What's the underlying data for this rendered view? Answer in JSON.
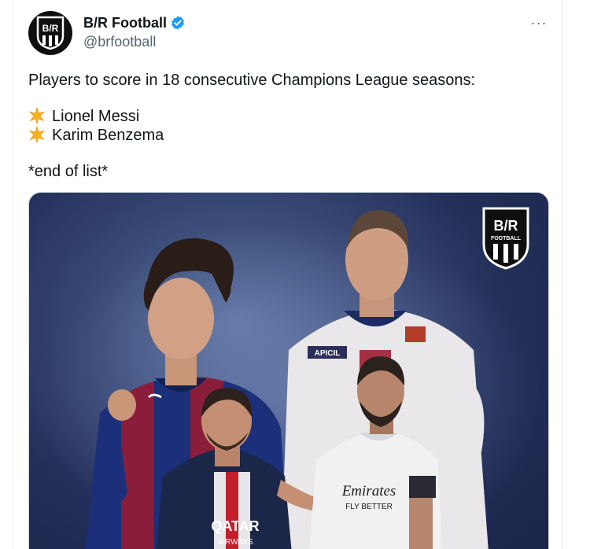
{
  "account": {
    "name": "B/R Football",
    "handle": "@brfootball",
    "avatar_icon": "br-logo-icon",
    "verified_icon": "verified-badge-icon",
    "avatar_text": "B/R"
  },
  "menu": {
    "more_icon": "more-horizontal-icon",
    "more_label": "···"
  },
  "tweet": {
    "headline": "Players to score in 18 consecutive Champions League seasons:",
    "players": [
      {
        "icon": "star-emoji-icon",
        "name": "Lionel Messi"
      },
      {
        "icon": "star-emoji-icon",
        "name": "Karim Benzema"
      }
    ],
    "footer": "*end of list*"
  },
  "media": {
    "logo_text": "B/R",
    "logo_sub": "FOOTBALL",
    "shirt_text_messi_young": "",
    "shirt_text_benzema_young": "APICIL",
    "shirt_text_psg": "QATAR",
    "shirt_text_psg_sub": "AIRWAYS",
    "shirt_text_madrid": "Emirates",
    "shirt_text_madrid_sub": "FLY BETTER"
  },
  "colors": {
    "text": "#0f1419",
    "secondary": "#536471",
    "verified": "#1d9bf0",
    "border": "#cfd9de"
  }
}
